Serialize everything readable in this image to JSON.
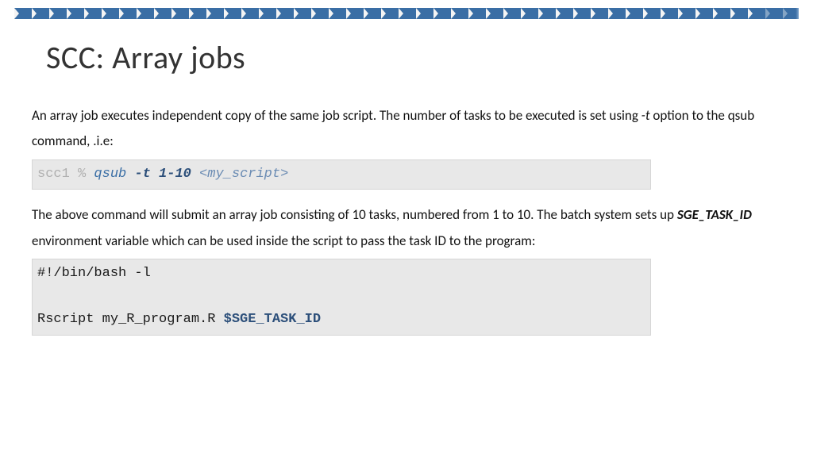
{
  "title": "SCC: Array jobs",
  "intro": {
    "part1": "An array job executes independent copy of the same job script. The number of tasks to be executed is set using  ",
    "flag": "-t",
    "part2": " option to the qsub command, .i.e:"
  },
  "code1": {
    "prompt": "scc1 % ",
    "cmd": "qsub ",
    "opt": "-t 1-10 ",
    "arg": "<my_script>"
  },
  "explain": {
    "part1": "The above command will submit an array job consisting of 10 tasks, numbered from 1 to 10. The batch system sets up ",
    "envvar": "SGE_TASK_ID",
    "part2": " environment variable which can be used inside the script to pass the task ID to the program:"
  },
  "code2": {
    "line1": "#!/bin/bash -l",
    "line2a": "Rscript my_R_program.R ",
    "line2b": "$SGE_TASK_ID"
  }
}
